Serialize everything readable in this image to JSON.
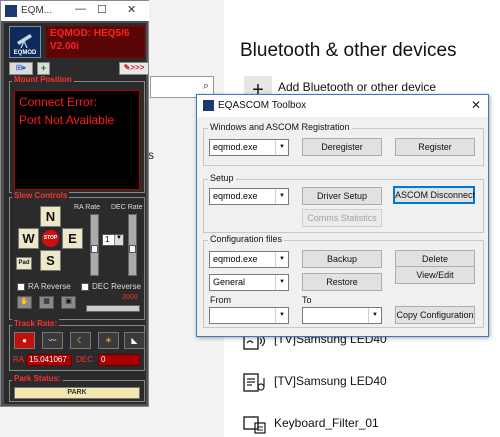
{
  "settings": {
    "heading": "Bluetooth & other devices",
    "add_device_label": "Add Bluetooth or other device",
    "add_plus": "+",
    "left_fragment": "s",
    "search_icon": "search-icon",
    "devices": [
      {
        "name": "[TV]Samsung LED40",
        "icon": "media-device-icon"
      },
      {
        "name": "[TV]Samsung LED40",
        "icon": "media-device-icon"
      },
      {
        "name": "Keyboard_Filter_01",
        "icon": "keyboard-device-icon"
      }
    ]
  },
  "eqmod": {
    "window_title": "EQM...",
    "window_buttons": {
      "minimize": "—",
      "maximize": "☐",
      "close": "✕"
    },
    "logo_text": "EQMOD",
    "banner_line1": "EQMOD: HEQ5/6",
    "banner_line2": "V2.00i",
    "toolbar_right": "✎>>>",
    "toolbar_left": "⊞▸",
    "toolbar_mid": "+",
    "mount_position_title": "Mount Position",
    "error_line1": "Connect Error:",
    "error_line2": "Port Not Available",
    "slew_controls_title": "Slew Controls",
    "dir_north": "N",
    "dir_west": "W",
    "dir_east": "E",
    "dir_south": "S",
    "stop_label": "STOP",
    "pad_label": "Pad",
    "ra_rate_label": "RA Rate",
    "dec_rate_label": "DEC Rate",
    "rate_value": "1",
    "ra_reverse_label": "RA Reverse",
    "dec_reverse_label": "DEC Reverse",
    "slider_value": "2000",
    "track_rate_title": "Track Rate:",
    "ra_label": "RA",
    "ra_value": "15.041067",
    "dec_label": "DEC",
    "dec_value": "0",
    "park_status_title": "Park Status:",
    "park_button": "PARK",
    "colors": {
      "accent_red": "#ff2020",
      "banner_bg": "#5a0606",
      "panel_bg": "#2b2b2b"
    }
  },
  "toolbox": {
    "title": "EQASCOM Toolbox",
    "close_glyph": "✕",
    "registration": {
      "label": "Windows and ASCOM Registration",
      "combo_value": "eqmod.exe",
      "deregister": "Deregister",
      "register": "Register"
    },
    "setup": {
      "label": "Setup",
      "combo_value": "eqmod.exe",
      "driver_setup": "Driver Setup",
      "ascom_disconnect": "ASCOM Disconnect",
      "comms_statistics": "Comms Statistics"
    },
    "config": {
      "label": "Configuration files",
      "combo_value": "eqmod.exe",
      "combo2_value": "General",
      "backup": "Backup",
      "restore": "Restore",
      "delete": "Delete",
      "view_edit": "View/Edit",
      "from_label": "From",
      "to_label": "To",
      "from_value": "",
      "to_value": "",
      "copy_configuration": "Copy Configuration"
    }
  }
}
